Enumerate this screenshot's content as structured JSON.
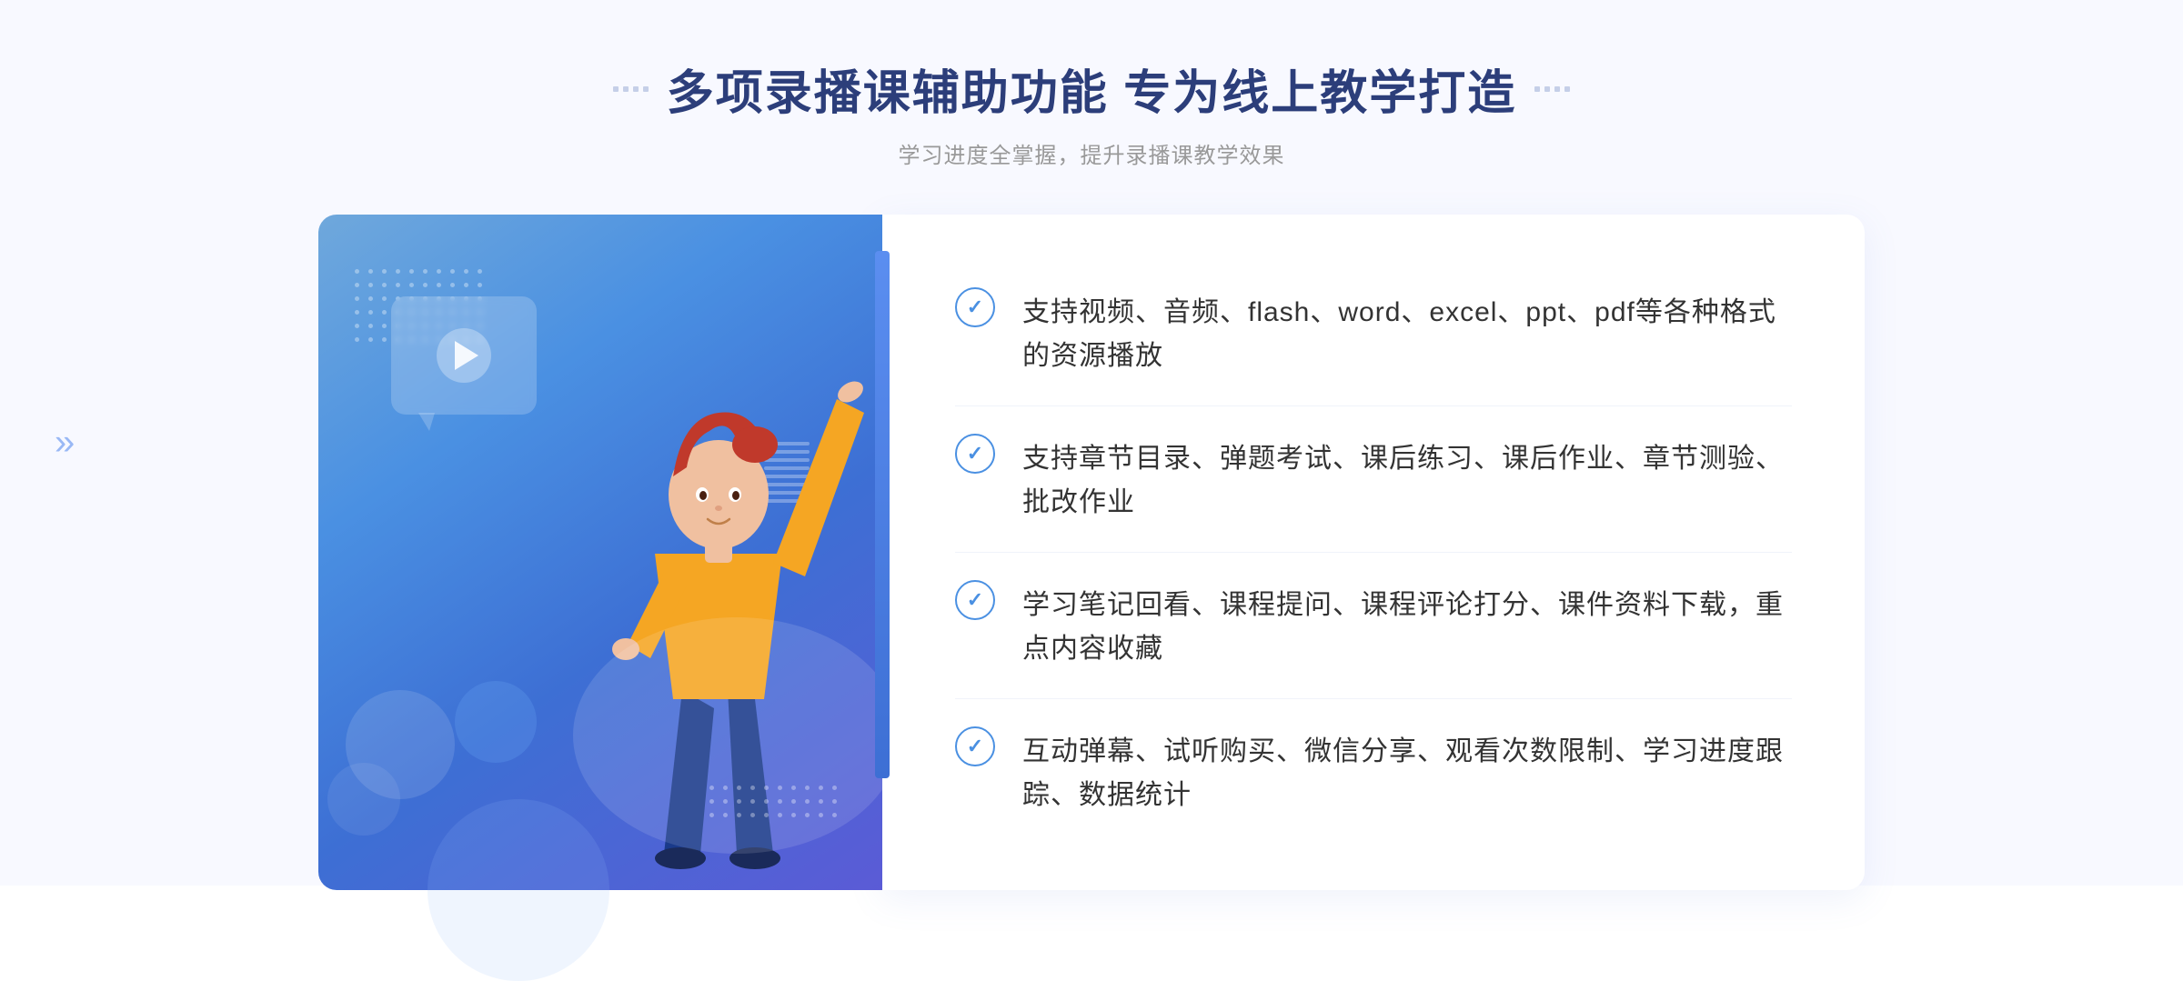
{
  "page": {
    "background": "#f8f9ff"
  },
  "header": {
    "title": "多项录播课辅助功能 专为线上教学打造",
    "subtitle": "学习进度全掌握，提升录播课教学效果",
    "decorators_left": [
      "·",
      "·",
      "·",
      "·"
    ],
    "decorators_right": [
      "·",
      "·",
      "·",
      "·"
    ]
  },
  "features": [
    {
      "id": 1,
      "text": "支持视频、音频、flash、word、excel、ppt、pdf等各种格式的资源播放"
    },
    {
      "id": 2,
      "text": "支持章节目录、弹题考试、课后练习、课后作业、章节测验、批改作业"
    },
    {
      "id": 3,
      "text": "学习笔记回看、课程提问、课程评论打分、课件资料下载，重点内容收藏"
    },
    {
      "id": 4,
      "text": "互动弹幕、试听购买、微信分享、观看次数限制、学习进度跟踪、数据统计"
    }
  ],
  "illustration": {
    "play_label": "播放",
    "arrow_left": "»"
  }
}
